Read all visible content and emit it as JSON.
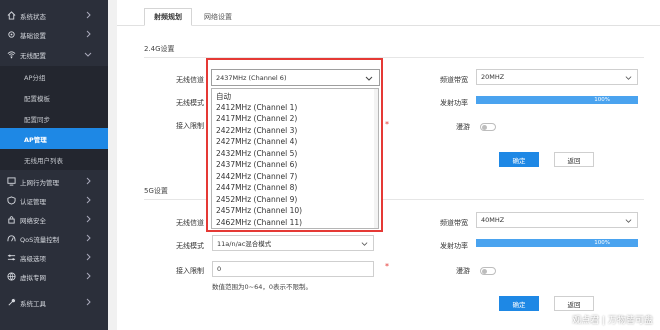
{
  "sidebar": {
    "items": [
      {
        "label": "系统状态",
        "icon": "home-icon"
      },
      {
        "label": "基础设置",
        "icon": "gear-icon"
      },
      {
        "label": "无线配置",
        "icon": "wifi-icon"
      }
    ],
    "sub_items": [
      {
        "label": "AP分组"
      },
      {
        "label": "配置模板"
      },
      {
        "label": "配置同步"
      },
      {
        "label": "AP管理",
        "active": true
      },
      {
        "label": "无线用户列表"
      }
    ],
    "lower_items": [
      {
        "label": "上网行为管理",
        "icon": "network-icon"
      },
      {
        "label": "认证管理",
        "icon": "shield-icon"
      },
      {
        "label": "网络安全",
        "icon": "lock-icon"
      },
      {
        "label": "QoS流量控制",
        "icon": "speed-icon"
      },
      {
        "label": "高级选项",
        "icon": "sliders-icon"
      },
      {
        "label": "虚拟专网",
        "icon": "globe-icon"
      },
      {
        "label": "系统工具",
        "icon": "tools-icon"
      }
    ]
  },
  "tabs": [
    {
      "label": "射频规划",
      "active": true
    },
    {
      "label": "网络设置",
      "active": false
    }
  ],
  "band24": {
    "title": "2.4G设置",
    "channel_label": "无线信道",
    "channel_value": "2437MHz (Channel 6)",
    "mode_label": "无线模式",
    "limit_label": "接入限制",
    "bandwidth_label": "频道带宽",
    "bandwidth_value": "20MHZ",
    "power_label": "发射功率",
    "power_value": "100%",
    "power_fraction": 1.0,
    "roaming_label": "漫游",
    "confirm_label": "确定",
    "back_label": "返回"
  },
  "dropdown": {
    "options": [
      "自动",
      "2412MHz (Channel 1)",
      "2417MHz (Channel 2)",
      "2422MHz (Channel 3)",
      "2427MHz (Channel 4)",
      "2432MHz (Channel 5)",
      "2437MHz (Channel 6)",
      "2442MHz (Channel 7)",
      "2447MHz (Channel 8)",
      "2452MHz (Channel 9)",
      "2457MHz (Channel 10)",
      "2462MHz (Channel 11)"
    ]
  },
  "band5": {
    "title": "5G设置",
    "channel_label": "无线信道",
    "mode_label": "无线模式",
    "mode_value": "11a/n/ac混合模式",
    "limit_label": "接入限制",
    "limit_value": "0",
    "limit_hint": "数值范围为0~64，0表示不限制。",
    "bandwidth_label": "频道带宽",
    "bandwidth_value": "40MHZ",
    "power_label": "发射功率",
    "power_value": "100%",
    "power_fraction": 1.0,
    "roaming_label": "漫游",
    "confirm_label": "确定",
    "back_label": "返回"
  },
  "watermark": "观点君 | 万物皆可盘",
  "colors": {
    "sidebar_bg": "#2b2f3a",
    "accent": "#1e88e5",
    "highlight_border": "#e53935"
  }
}
